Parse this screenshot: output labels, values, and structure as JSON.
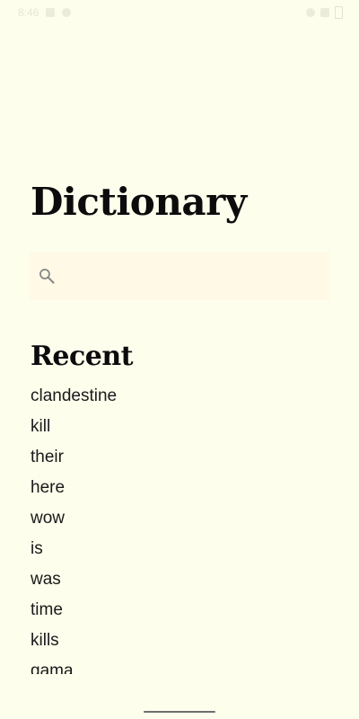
{
  "app": {
    "title": "Dictionary"
  },
  "status_bar": {
    "time": "8:46",
    "icons": [
      "notification-icon",
      "settings-icon",
      "wifi-icon",
      "signal-icon",
      "battery-icon"
    ]
  },
  "search": {
    "placeholder": "",
    "value": "",
    "icon": "search-icon"
  },
  "recent": {
    "heading": "Recent",
    "items": [
      "clandestine",
      "kill",
      "their",
      "here",
      "wow",
      "is",
      "was",
      "time",
      "kills",
      "gama"
    ]
  },
  "colors": {
    "background": "#fefeec",
    "search_background": "#fff9e6",
    "text": "#0c0c0c",
    "icon_gray": "#8a8a8a"
  }
}
